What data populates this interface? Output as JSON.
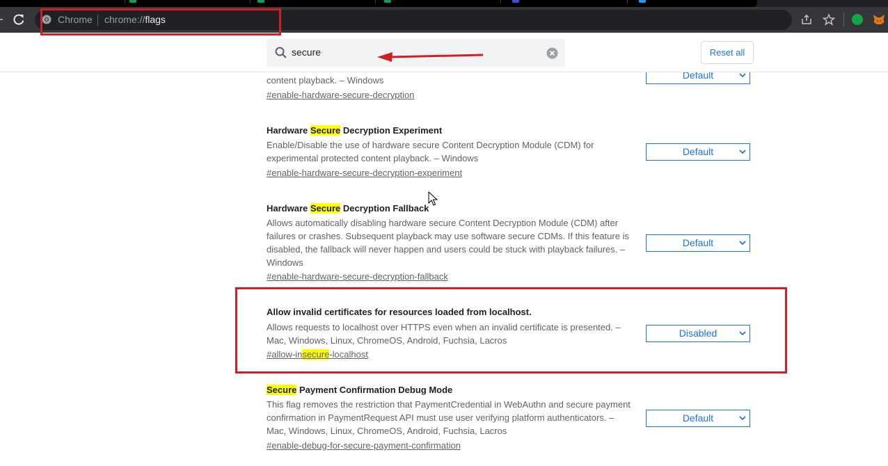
{
  "browser": {
    "omnibox_chip": "Chrome",
    "url_scheme": "chrome://",
    "url_host": "flags"
  },
  "header": {
    "search_value": "secure",
    "reset_label": "Reset all"
  },
  "experiments": [
    {
      "desc": "content playback. – Windows",
      "link": "#enable-hardware-secure-decryption",
      "select": "Default"
    },
    {
      "title_hl": "Secure",
      "title_pre": "Hardware ",
      "title_post": " Decryption Experiment",
      "desc": "Enable/Disable the use of hardware secure Content Decryption Module (CDM) for experimental protected content playback. – Windows",
      "link": "#enable-hardware-secure-decryption-experiment",
      "select": "Default"
    },
    {
      "title_pre": "Hardware ",
      "title_hl": "Secure",
      "title_post": " Decryption Fallback",
      "desc": "Allows automatically disabling hardware secure Content Decryption Module (CDM) after failures or crashes. Subsequent playback may use software secure CDMs. If this feature is disabled, the fallback will never happen and users could be stuck with playback failures. – Windows",
      "link": "#enable-hardware-secure-decryption-fallback",
      "select": "Default"
    },
    {
      "title": "Allow invalid certificates for resources loaded from localhost.",
      "desc": "Allows requests to localhost over HTTPS even when an invalid certificate is presented. – Mac, Windows, Linux, ChromeOS, Android, Fuchsia, Lacros",
      "link_pre": "#allow-in",
      "link_hl": "secure",
      "link_post": "-localhost",
      "select": "Disabled"
    },
    {
      "title_hl": "Secure",
      "title_post": " Payment Confirmation Debug Mode",
      "desc": "This flag removes the restriction that PaymentCredential in WebAuthn and secure payment confirmation in PaymentRequest API must use user verifying platform authenticators. – Mac, Windows, Linux, ChromeOS, Android, Fuchsia, Lacros",
      "link": "#enable-debug-for-secure-payment-confirmation",
      "select": "Default"
    }
  ],
  "colors": {
    "annotation": "#d11f26",
    "highlight": "#ffff00",
    "accent": "#1a73e8"
  },
  "icons": {
    "reload": "reload-icon",
    "search": "search-icon",
    "clear": "clear-icon",
    "share": "share-icon",
    "star": "star-icon"
  }
}
